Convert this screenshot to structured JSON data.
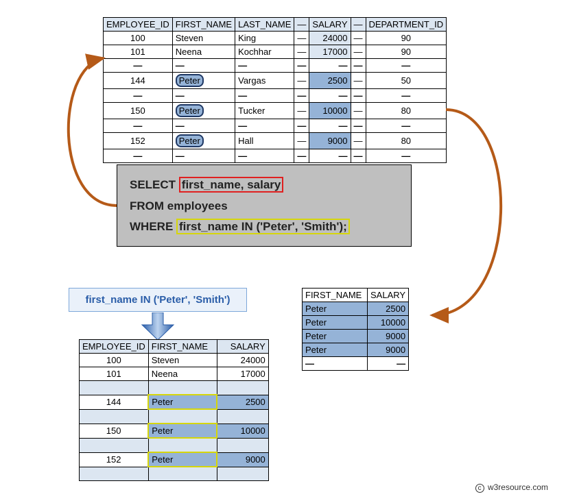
{
  "top_table": {
    "headers": [
      "EMPLOYEE_ID",
      "FIRST_NAME",
      "LAST_NAME",
      "—",
      "SALARY",
      "—",
      "DEPARTMENT_ID"
    ],
    "rows": [
      {
        "id": "100",
        "fn": "Steven",
        "ln": "King",
        "d1": "—",
        "sal": "24000",
        "d2": "—",
        "dept": "90",
        "peter": false
      },
      {
        "id": "101",
        "fn": "Neena",
        "ln": "Kochhar",
        "d1": "—",
        "sal": "17000",
        "d2": "—",
        "dept": "90",
        "peter": false
      },
      {
        "id": "—",
        "fn": "—",
        "ln": "—",
        "d1": "—",
        "sal": "—",
        "d2": "—",
        "dept": "—",
        "peter": false,
        "dashrow": true
      },
      {
        "id": "144",
        "fn": "Peter",
        "ln": "Vargas",
        "d1": "—",
        "sal": "2500",
        "d2": "—",
        "dept": "50",
        "peter": true
      },
      {
        "id": "—",
        "fn": "—",
        "ln": "—",
        "d1": "—",
        "sal": "—",
        "d2": "—",
        "dept": "—",
        "peter": false,
        "dashrow": true
      },
      {
        "id": "150",
        "fn": "Peter",
        "ln": "Tucker",
        "d1": "—",
        "sal": "10000",
        "d2": "—",
        "dept": "80",
        "peter": true
      },
      {
        "id": "—",
        "fn": "—",
        "ln": "—",
        "d1": "—",
        "sal": "—",
        "d2": "—",
        "dept": "—",
        "peter": false,
        "dashrow": true
      },
      {
        "id": "152",
        "fn": "Peter",
        "ln": "Hall",
        "d1": "—",
        "sal": "9000",
        "d2": "—",
        "dept": "80",
        "peter": true
      },
      {
        "id": "—",
        "fn": "—",
        "ln": "—",
        "d1": "—",
        "sal": "—",
        "d2": "—",
        "dept": "—",
        "peter": false,
        "dashrow": true
      }
    ]
  },
  "sql": {
    "select": "SELECT",
    "cols": "first_name, salary",
    "from": "FROM employees",
    "where": "WHERE",
    "cond": "first_name IN ('Peter', 'Smith');"
  },
  "filter_label": "first_name IN ('Peter', 'Smith')",
  "bottom_left": {
    "headers": [
      "EMPLOYEE_ID",
      "FIRST_NAME",
      "SALARY"
    ],
    "rows": [
      {
        "id": "100",
        "fn": "Steven",
        "sal": "24000",
        "hl": false
      },
      {
        "id": "101",
        "fn": "Neena",
        "sal": "17000",
        "hl": false
      },
      {
        "id": "",
        "fn": "",
        "sal": "",
        "hl": false,
        "empty": true
      },
      {
        "id": "144",
        "fn": "Peter",
        "sal": "2500",
        "hl": true
      },
      {
        "id": "",
        "fn": "",
        "sal": "",
        "hl": false,
        "empty": true
      },
      {
        "id": "150",
        "fn": "Peter",
        "sal": "10000",
        "hl": true
      },
      {
        "id": "",
        "fn": "",
        "sal": "",
        "hl": false,
        "empty": true
      },
      {
        "id": "152",
        "fn": "Peter",
        "sal": "9000",
        "hl": true
      },
      {
        "id": "",
        "fn": "",
        "sal": "",
        "hl": false,
        "empty": true
      }
    ]
  },
  "result": {
    "headers": [
      "FIRST_NAME",
      "SALARY"
    ],
    "rows": [
      {
        "fn": "Peter",
        "sal": "2500"
      },
      {
        "fn": "Peter",
        "sal": "10000"
      },
      {
        "fn": "Peter",
        "sal": "9000"
      },
      {
        "fn": "Peter",
        "sal": "9000"
      },
      {
        "fn": "—",
        "sal": "—",
        "dashrow": true
      }
    ]
  },
  "footer": "w3resource.com"
}
